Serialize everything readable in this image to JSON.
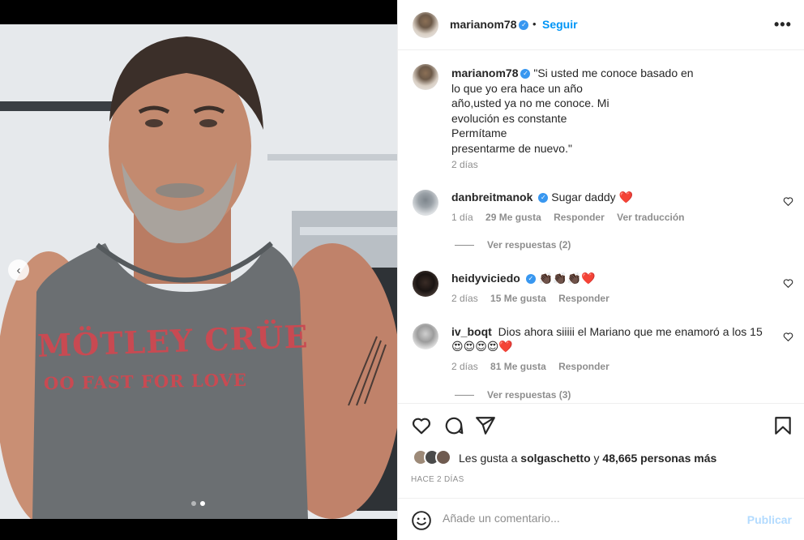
{
  "post": {
    "author": "marianom78",
    "follow_label": "Seguir",
    "more_label": "•••",
    "separator": "•",
    "caption": "\"Si usted me conoce basado en\nlo que yo era hace un año\naño,usted ya no me conoce. Mi\nevolución es constante\nPermítame\npresentarme de nuevo.\"",
    "caption_time": "2 días",
    "shirt_text_line1": "MÖTLEY CRÜE",
    "shirt_text_line2": "OO FAST FOR LOVE",
    "carousel": {
      "total": 2,
      "active": 2
    }
  },
  "comments": [
    {
      "user": "danbreitmanok",
      "verified": true,
      "text": "Sugar daddy ❤️",
      "time": "1 día",
      "likes": "29 Me gusta",
      "reply": "Responder",
      "translate": "Ver traducción",
      "replies_label": "Ver respuestas (2)"
    },
    {
      "user": "heidyviciedo",
      "verified": true,
      "text": "👏🏿👏🏿👏🏿❤️",
      "time": "2 días",
      "likes": "15 Me gusta",
      "reply": "Responder"
    },
    {
      "user": "iv_boqt",
      "verified": false,
      "text": "Dios ahora siiiii el Mariano que me enamoró a los 15",
      "text2": "😍😍😍😍❤️",
      "time": "2 días",
      "likes": "81 Me gusta",
      "reply": "Responder",
      "replies_label": "Ver respuestas (3)"
    }
  ],
  "likes": {
    "prefix": "Les gusta a",
    "user": "solgaschetto",
    "middle": "y",
    "count": "48,665 personas más"
  },
  "timestamp": "HACE 2 DÍAS",
  "add_comment": {
    "placeholder": "Añade un comentario...",
    "publish_label": "Publicar"
  },
  "icons": [
    "heart-icon",
    "comment-icon",
    "share-icon",
    "bookmark-icon",
    "emoji-icon",
    "chevron-left-icon",
    "verified-icon"
  ],
  "colors": {
    "accent": "#0095f6",
    "publish_disabled": "#b3dbff",
    "heart": "#ed4956",
    "shirt_print": "#c84a52",
    "muted_text": "#8e8e8e"
  }
}
